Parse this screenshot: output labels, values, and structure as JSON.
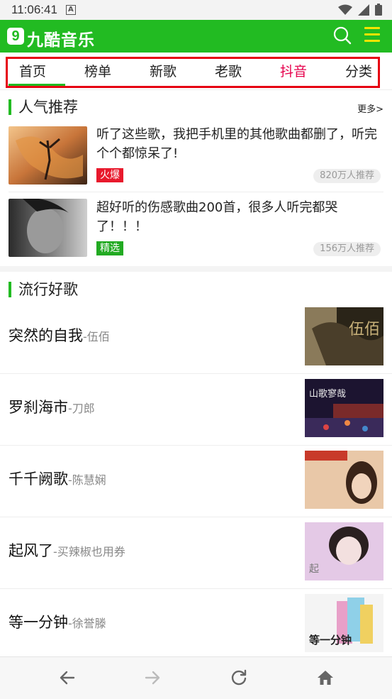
{
  "status": {
    "time": "11:06:41",
    "a_icon": "A"
  },
  "app": {
    "logo_badge": "9",
    "logo_text": "九酷音乐"
  },
  "tabs": [
    {
      "label": "首页"
    },
    {
      "label": "榜单"
    },
    {
      "label": "新歌"
    },
    {
      "label": "老歌"
    },
    {
      "label": "抖音"
    },
    {
      "label": "分类"
    }
  ],
  "popular": {
    "title": "人气推荐",
    "more": "更多>",
    "items": [
      {
        "title": "听了这些歌，我把手机里的其他歌曲都删了，听完个个都惊呆了!",
        "tag": "火爆",
        "tag_color": "#e8192c",
        "count": "820万人推荐"
      },
      {
        "title": "超好听的伤感歌曲200首，很多人听完都哭了！！！",
        "tag": "精选",
        "tag_color": "#22aa22",
        "count": "156万人推荐"
      }
    ]
  },
  "trending": {
    "title": "流行好歌",
    "songs": [
      {
        "name": "突然的自我",
        "artist": "-伍佰"
      },
      {
        "name": "罗刹海市",
        "artist": "-刀郎"
      },
      {
        "name": "千千阙歌",
        "artist": "-陈慧娴"
      },
      {
        "name": "起风了",
        "artist": "-买辣椒也用券"
      },
      {
        "name": "等一分钟",
        "artist": "-徐誉滕"
      }
    ]
  },
  "colors": {
    "brand": "#22bb22",
    "highlight_tab": "#e6004c",
    "outline": "#e60012"
  },
  "icons": {
    "search": "search-icon",
    "menu": "menu-icon",
    "back": "back-arrow-icon",
    "forward": "forward-arrow-icon",
    "refresh": "refresh-icon",
    "home": "home-icon"
  }
}
